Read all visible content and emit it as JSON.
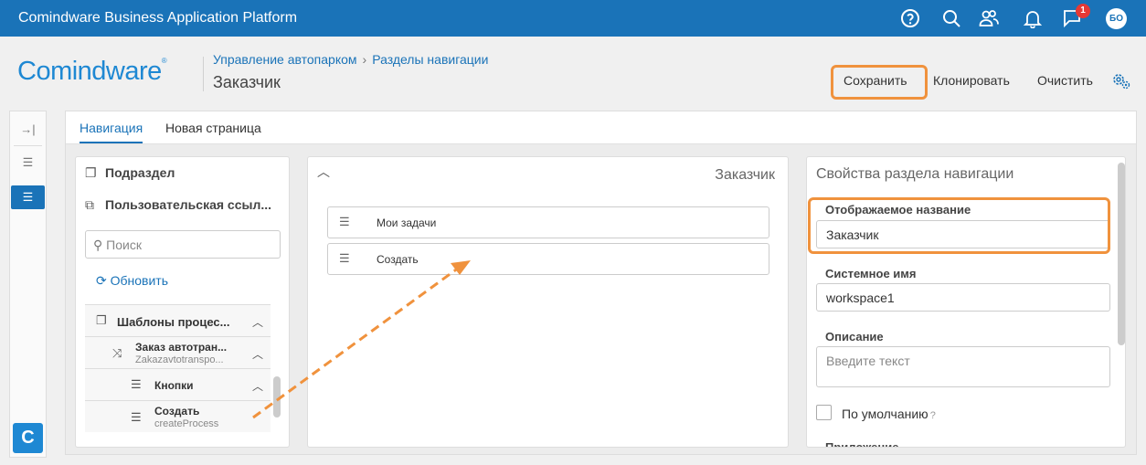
{
  "topbar": {
    "title": "Comindware Business Application Platform",
    "icons": [
      "help-icon",
      "search-icon",
      "users-icon",
      "bell-icon",
      "chat-icon"
    ],
    "notification_count": "1",
    "avatar_initials": "БО"
  },
  "header": {
    "logo": "Comindware",
    "logo_mark": "®",
    "breadcrumb": [
      "Управление автопарком",
      "Разделы навигации"
    ],
    "page_title": "Заказчик"
  },
  "toolbar": {
    "save_label": "Сохранить",
    "clone_label": "Клонировать",
    "clear_label": "Очистить"
  },
  "rail": {
    "logo_letter": "C"
  },
  "tabs": [
    {
      "label": "Навигация",
      "active": true
    },
    {
      "label": "Новая страница",
      "active": false
    }
  ],
  "left_panel": {
    "items": [
      {
        "label": "Подраздел",
        "icon": "copy-icon"
      },
      {
        "label": "Пользовательская ссыл...",
        "icon": "external-link-icon"
      }
    ],
    "search_placeholder": "Поиск",
    "refresh_label": "Обновить",
    "tree": [
      {
        "label": "Шаблоны процес...",
        "sub": "",
        "icon": "copy-icon"
      },
      {
        "label": "Заказ автотран...",
        "sub": "Zakazavtotranspo...",
        "icon": "shuffle-icon"
      },
      {
        "label": "Кнопки",
        "sub": "",
        "icon": "list-icon"
      },
      {
        "label": "Создать",
        "sub": "createProcess",
        "icon": "list-icon"
      }
    ]
  },
  "middle_panel": {
    "title": "Заказчик",
    "items": [
      {
        "label": "Мои задачи",
        "icon": "task-list-icon"
      },
      {
        "label": "Создать",
        "icon": "list-icon"
      }
    ]
  },
  "right_panel": {
    "title": "Свойства раздела навигации",
    "display_name_label": "Отображаемое название",
    "display_name_value": "Заказчик",
    "system_name_label": "Системное имя",
    "system_name_value": "workspace1",
    "description_label": "Описание",
    "description_placeholder": "Введите текст",
    "default_label": "По умолчанию",
    "app_label": "Приложение"
  },
  "colors": {
    "accent": "#1a73b8",
    "highlight": "#f0923d"
  }
}
